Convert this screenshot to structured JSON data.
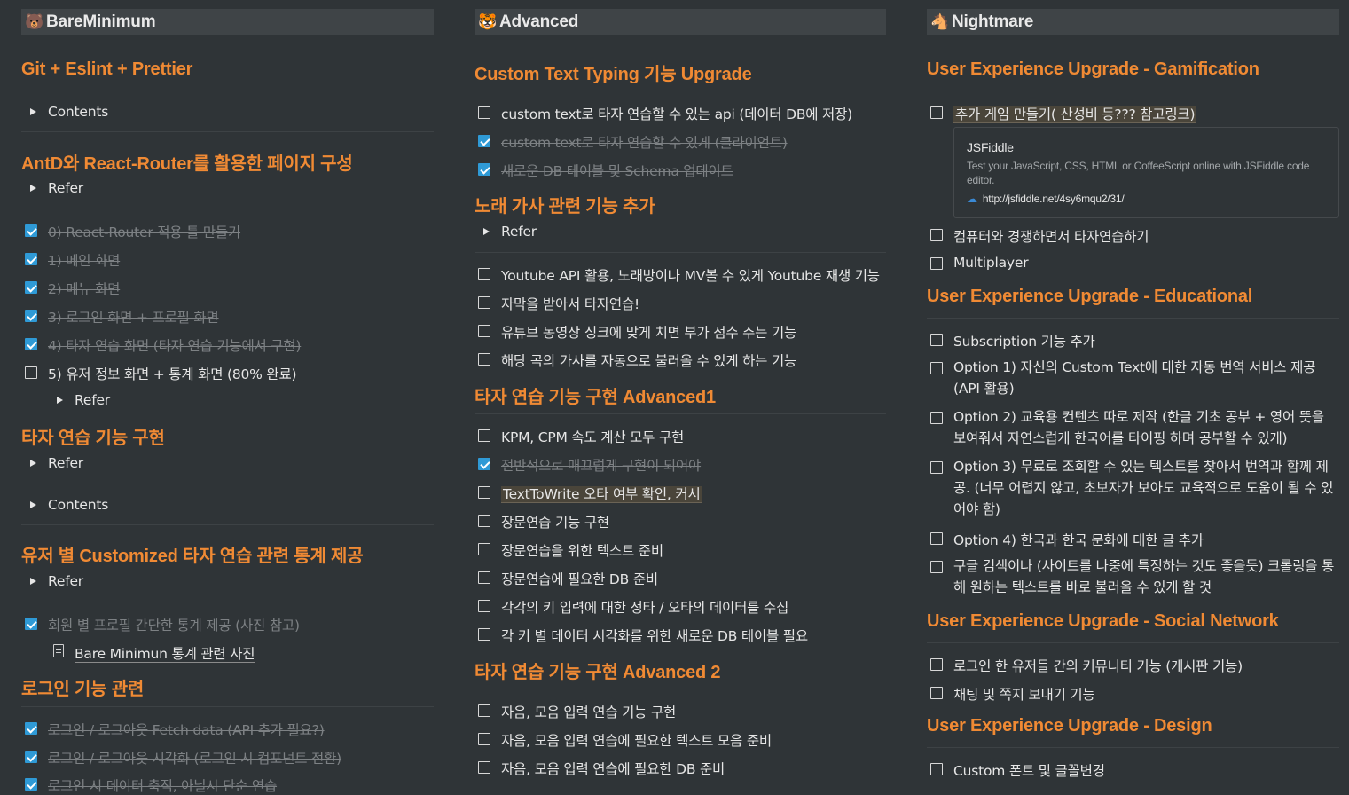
{
  "columns": [
    {
      "title": "BareMinimum",
      "emoji": "🐻",
      "sections": [
        {
          "heading": "Git + Eslint + Prettier",
          "toggles": [
            "Contents"
          ]
        },
        {
          "heading": "AntD와 React-Router를 활용한 페이지 구성",
          "toggles": [
            "Refer"
          ],
          "todos": [
            {
              "text": "0) React-Router 적용 틀 만들기",
              "checked": true
            },
            {
              "text": "1) 메인 화면",
              "checked": true
            },
            {
              "text": "2) 메뉴 화면",
              "checked": true
            },
            {
              "text": "3) 로그인 화면 + 프로필 화면",
              "checked": true
            },
            {
              "text": "4) 타자 연습 화면 (타자 연습 기능에서 구현)",
              "checked": true
            },
            {
              "text": "5) 유저 정보 화면 + 통계 화면 (80% 완료)",
              "checked": false
            }
          ],
          "nested_toggle": "Refer"
        },
        {
          "heading": "타자 연습 기능 구현",
          "toggles": [
            "Refer",
            "Contents"
          ]
        },
        {
          "heading": "유저 별 Customized 타자 연습 관련 통계 제공",
          "toggles": [
            "Refer"
          ],
          "todos": [
            {
              "text": "회원 별 프로필 간단한 통계 제공 (사진 참고)",
              "checked": true
            }
          ],
          "page_link": "Bare Minimun 통계 관련 사진"
        },
        {
          "heading": "로그인 기능 관련",
          "todos": [
            {
              "text": "로그인 / 로그아웃 Fetch data (API 추가 필요?)",
              "checked": true
            },
            {
              "text": "로그인 / 로그아웃 시각화 (로그인 시 컴포넌트 전환)",
              "checked": true
            },
            {
              "text": "로그인 시 데이터 축적, 아닐시 단순 연습",
              "checked": true
            }
          ]
        }
      ]
    },
    {
      "title": "Advanced",
      "emoji": "🐯",
      "sections": [
        {
          "heading": "Custom Text Typing 기능 Upgrade",
          "todos": [
            {
              "text": "custom text로 타자 연습할 수 있는 api (데이터 DB에 저장)",
              "checked": false
            },
            {
              "text": "custom text로 타자 연습할 수 있게 (클라이언트)",
              "checked": true
            },
            {
              "text": "새로운 DB 테이블 및 Schema 업데이트",
              "checked": true
            }
          ]
        },
        {
          "heading": "노래 가사 관련 기능 추가",
          "toggles": [
            "Refer"
          ],
          "todos": [
            {
              "text": "Youtube API 활용, 노래방이나 MV볼 수 있게 Youtube 재생 기능",
              "checked": false
            },
            {
              "text": "자막을 받아서 타자연습!",
              "checked": false
            },
            {
              "text": "유튜브 동영상 싱크에 맞게 치면 부가 점수 주는 기능",
              "checked": false
            },
            {
              "text": "해당 곡의 가사를 자동으로 불러올 수 있게 하는 기능",
              "checked": false
            }
          ]
        },
        {
          "heading": "타자 연습 기능 구현 Advanced1",
          "todos": [
            {
              "text": "KPM, CPM 속도 계산 모두 구현",
              "checked": false
            },
            {
              "text": "전반적으로 매끄럽게 구현이 되어야",
              "checked": true
            },
            {
              "text": "TextToWrite 오타 여부 확인, 커서",
              "checked": false,
              "highlight": true
            },
            {
              "text": "장문연습 기능 구현",
              "checked": false
            },
            {
              "text": "장문연습을 위한 텍스트 준비",
              "checked": false
            },
            {
              "text": "장문연습에 필요한 DB 준비",
              "checked": false
            },
            {
              "text": "각각의 키 입력에 대한 정타 / 오타의 데이터를 수집",
              "checked": false
            },
            {
              "text": "각 키 별 데이터 시각화를 위한 새로운 DB 테이블 필요",
              "checked": false
            }
          ]
        },
        {
          "heading": "타자 연습 기능 구현 Advanced 2",
          "todos": [
            {
              "text": "자음, 모음 입력 연습 기능 구현",
              "checked": false
            },
            {
              "text": "자음, 모음 입력 연습에 필요한 텍스트 모음 준비",
              "checked": false
            },
            {
              "text": "자음, 모음 입력 연습에 필요한 DB 준비",
              "checked": false
            }
          ]
        }
      ]
    },
    {
      "title": "Nightmare",
      "emoji": "🐴",
      "sections": [
        {
          "heading": "User Experience Upgrade - Gamification",
          "todos": [
            {
              "text": "추가 게임 만들기( 산성비 등???  참고링크)",
              "checked": false,
              "highlight": true
            },
            {
              "text": "컴퓨터와 경쟁하면서 타자연습하기",
              "checked": false
            },
            {
              "text": "Multiplayer",
              "checked": false
            }
          ],
          "bookmark": {
            "title": "JSFiddle",
            "description": "Test your JavaScript, CSS, HTML or CoffeeScript online with JSFiddle code editor.",
            "url": "http://jsfiddle.net/4sy6mqu2/31/"
          }
        },
        {
          "heading": "User Experience Upgrade - Educational",
          "todos": [
            {
              "text": "Subscription 기능 추가",
              "checked": false
            },
            {
              "text": "Option 1) 자신의 Custom Text에 대한 자동 번역 서비스 제공 (API 활용)",
              "checked": false
            },
            {
              "text": "Option 2) 교육용 컨텐츠 따로 제작 (한글 기초 공부 + 영어 뜻을 보여줘서 자연스럽게 한국어를 타이핑 하며 공부할 수 있게)",
              "checked": false
            },
            {
              "text": "Option 3) 무료로 조회할 수 있는 텍스트를 찾아서 번역과 함께 제공. (너무 어렵지 않고, 초보자가 보아도 교육적으로 도움이 될 수 있어야 함)",
              "checked": false
            },
            {
              "text": "Option 4) 한국과 한국 문화에 대한 글 추가",
              "checked": false
            },
            {
              "text": "구글 검색이나 (사이트를 나중에 특정하는 것도 좋을듯) 크롤링을 통해 원하는 텍스트를 바로 불러올 수 있게 할 것",
              "checked": false
            }
          ]
        },
        {
          "heading": "User Experience Upgrade - Social Network",
          "todos": [
            {
              "text": "로그인 한 유저들 간의 커뮤니티 기능 (게시판 기능)",
              "checked": false
            },
            {
              "text": "채팅 및 쪽지 보내기 기능",
              "checked": false
            }
          ]
        },
        {
          "heading": "User Experience Upgrade - Design",
          "todos": [
            {
              "text": "Custom 폰트 및 글꼴변경",
              "checked": false
            }
          ]
        }
      ]
    }
  ]
}
